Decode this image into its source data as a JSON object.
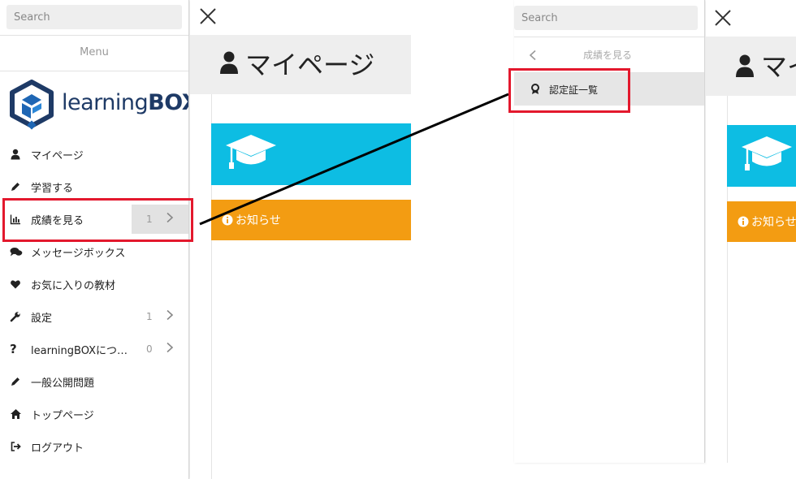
{
  "left_sidebar": {
    "search_placeholder": "Search",
    "menu_label": "Menu",
    "logo": {
      "text_light": "learning",
      "text_bold": "BOX"
    },
    "items": [
      {
        "label": "マイページ",
        "icon": "user-icon"
      },
      {
        "label": "学習する",
        "icon": "pencil-icon"
      },
      {
        "label": "成績を見る",
        "icon": "bar-chart-icon",
        "count": "1",
        "has_children": true
      },
      {
        "label": "メッセージボックス",
        "icon": "comments-icon"
      },
      {
        "label": "お気に入りの教材",
        "icon": "heart-icon"
      },
      {
        "label": "設定",
        "icon": "wrench-icon",
        "count": "1",
        "has_children": true
      },
      {
        "label": "learningBOXにつ…",
        "icon": "question-icon",
        "count": "0",
        "has_children": true
      },
      {
        "label": "一般公開問題",
        "icon": "pencil-icon"
      },
      {
        "label": "トップページ",
        "icon": "home-icon"
      },
      {
        "label": "ログアウト",
        "icon": "sign-out-icon"
      }
    ]
  },
  "main": {
    "page_title": "マイページ",
    "notice_label": "お知らせ",
    "notice_label_cropped": "お知らせ"
  },
  "submenu": {
    "search_placeholder": "Search",
    "back_label": "成績を見る",
    "items": [
      {
        "label": "認定証一覧",
        "icon": "certificate-icon"
      }
    ]
  },
  "colors": {
    "accent_blue": "#0dbde3",
    "notice_orange": "#f39c12",
    "highlight_red": "#e3182d",
    "logo_navy": "#1e3a66"
  }
}
